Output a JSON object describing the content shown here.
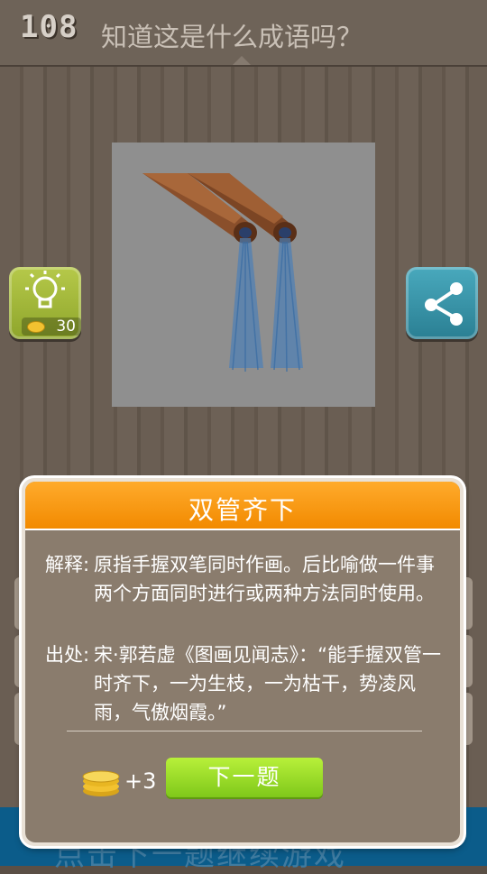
{
  "header": {
    "level": "108",
    "question": "知道这是什么成语吗？"
  },
  "hint": {
    "cost": "30"
  },
  "bottom_banner": {
    "text": "点击下一题继续游戏"
  },
  "dialog": {
    "title": "双管齐下",
    "meaning_label": "解释:",
    "meaning_text": "原指手握双笔同时作画。后比喻做一件事两个方面同时进行或两种方法同时使用。",
    "source_label": "出处:",
    "source_text": "宋·郭若虚《图画见闻志》：“能手握双管一时齐下，一为生枝，一为枯干，势凌风雨，气傲烟霞。”",
    "reward": "+3",
    "next_label": "下一题"
  },
  "icons": {
    "hint": "lightbulb-icon",
    "share": "share-icon",
    "coins": "coin-stack-icon"
  }
}
